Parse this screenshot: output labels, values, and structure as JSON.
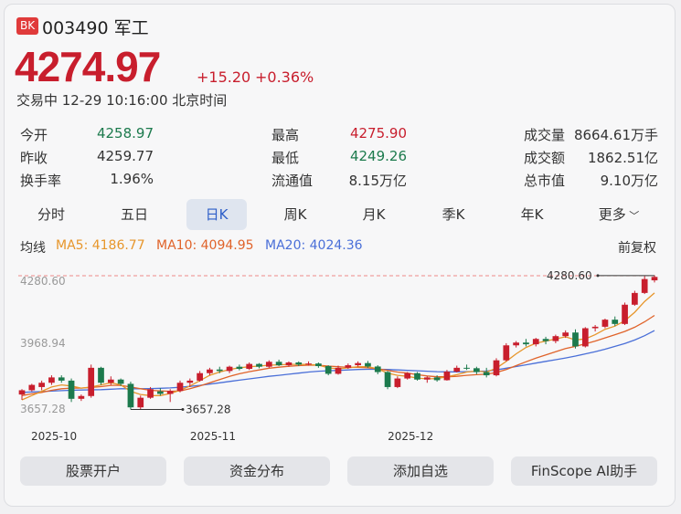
{
  "header": {
    "badge": "BK",
    "code_name": "003490 军工",
    "price": "4274.97",
    "change": "+15.20",
    "change_pct": "+0.36%",
    "status": "交易中 12-29 10:16:00 北京时间"
  },
  "stats": [
    {
      "label": "今开",
      "value": "4258.97",
      "color": "green"
    },
    {
      "label": "最高",
      "value": "4275.90",
      "color": "red"
    },
    {
      "label": "成交量",
      "value": "8664.61万手",
      "color": "dark"
    },
    {
      "label": "昨收",
      "value": "4259.77",
      "color": "dark"
    },
    {
      "label": "最低",
      "value": "4249.26",
      "color": "green"
    },
    {
      "label": "成交额",
      "value": "1862.51亿",
      "color": "dark"
    },
    {
      "label": "换手率",
      "value": "1.96%",
      "color": "dark"
    },
    {
      "label": "流通值",
      "value": "8.15万亿",
      "color": "dark"
    },
    {
      "label": "总市值",
      "value": "9.10万亿",
      "color": "dark"
    }
  ],
  "tabs": [
    "分时",
    "五日",
    "日K",
    "周K",
    "月K",
    "季K",
    "年K",
    "更多"
  ],
  "active_tab": "日K",
  "ma": {
    "label": "均线",
    "ma5": "MA5: 4186.77",
    "ma10": "MA10: 4094.95",
    "ma20": "MA20: 4024.36",
    "adjust": "前复权"
  },
  "colors": {
    "up": "#c81e2d",
    "down": "#1c7a4d",
    "ma5": "#e7962b",
    "ma10": "#e0632a",
    "ma20": "#4a6fd8",
    "active_tab": "#2d5ec8"
  },
  "chart_data": {
    "type": "candlestick",
    "y_ticks": [
      "4280.60",
      "3968.94",
      "3657.28"
    ],
    "ylim": [
      3657.28,
      4280.6
    ],
    "x_labels": [
      "2025-10",
      "2025-11",
      "2025-12"
    ],
    "x_label_index": [
      0,
      17,
      37
    ],
    "max_label": "4280.60",
    "min_label": "3657.28",
    "ohlc": [
      [
        3725,
        3750,
        3700,
        3745
      ],
      [
        3745,
        3775,
        3740,
        3770
      ],
      [
        3760,
        3790,
        3745,
        3780
      ],
      [
        3780,
        3815,
        3770,
        3805
      ],
      [
        3805,
        3815,
        3780,
        3790
      ],
      [
        3790,
        3800,
        3690,
        3705
      ],
      [
        3705,
        3725,
        3695,
        3718
      ],
      [
        3718,
        3865,
        3710,
        3850
      ],
      [
        3850,
        3855,
        3770,
        3780
      ],
      [
        3780,
        3810,
        3770,
        3795
      ],
      [
        3795,
        3800,
        3765,
        3775
      ],
      [
        3775,
        3785,
        3655,
        3665
      ],
      [
        3665,
        3720,
        3655,
        3710
      ],
      [
        3710,
        3760,
        3705,
        3750
      ],
      [
        3740,
        3755,
        3720,
        3728
      ],
      [
        3728,
        3750,
        3690,
        3742
      ],
      [
        3742,
        3790,
        3735,
        3780
      ],
      [
        3780,
        3800,
        3760,
        3790
      ],
      [
        3790,
        3835,
        3785,
        3825
      ],
      [
        3825,
        3850,
        3815,
        3842
      ],
      [
        3842,
        3855,
        3825,
        3835
      ],
      [
        3835,
        3860,
        3825,
        3855
      ],
      [
        3855,
        3865,
        3838,
        3845
      ],
      [
        3845,
        3875,
        3840,
        3868
      ],
      [
        3868,
        3872,
        3848,
        3855
      ],
      [
        3855,
        3885,
        3850,
        3878
      ],
      [
        3878,
        3888,
        3858,
        3862
      ],
      [
        3862,
        3880,
        3855,
        3875
      ],
      [
        3875,
        3880,
        3858,
        3865
      ],
      [
        3865,
        3880,
        3860,
        3870
      ],
      [
        3870,
        3875,
        3850,
        3858
      ],
      [
        3858,
        3862,
        3815,
        3822
      ],
      [
        3822,
        3860,
        3818,
        3850
      ],
      [
        3850,
        3870,
        3845,
        3862
      ],
      [
        3862,
        3880,
        3855,
        3872
      ],
      [
        3872,
        3882,
        3850,
        3856
      ],
      [
        3856,
        3862,
        3820,
        3830
      ],
      [
        3830,
        3835,
        3750,
        3760
      ],
      [
        3760,
        3810,
        3755,
        3800
      ],
      [
        3800,
        3830,
        3795,
        3825
      ],
      [
        3825,
        3830,
        3790,
        3795
      ],
      [
        3795,
        3810,
        3780,
        3805
      ],
      [
        3805,
        3815,
        3785,
        3792
      ],
      [
        3792,
        3840,
        3790,
        3832
      ],
      [
        3832,
        3860,
        3828,
        3850
      ],
      [
        3850,
        3865,
        3840,
        3848
      ],
      [
        3848,
        3855,
        3820,
        3830
      ],
      [
        3830,
        3850,
        3805,
        3815
      ],
      [
        3815,
        3895,
        3810,
        3885
      ],
      [
        3885,
        3965,
        3880,
        3955
      ],
      [
        3955,
        3975,
        3945,
        3968
      ],
      [
        3968,
        3985,
        3950,
        3960
      ],
      [
        3960,
        3990,
        3950,
        3985
      ],
      [
        3985,
        3995,
        3960,
        3975
      ],
      [
        3975,
        4005,
        3965,
        3998
      ],
      [
        3998,
        4025,
        3990,
        4015
      ],
      [
        4015,
        4030,
        3940,
        3950
      ],
      [
        3950,
        4040,
        3945,
        4035
      ],
      [
        4035,
        4050,
        4020,
        4042
      ],
      [
        4042,
        4080,
        4035,
        4075
      ],
      [
        4075,
        4090,
        4045,
        4055
      ],
      [
        4055,
        4155,
        4050,
        4145
      ],
      [
        4145,
        4210,
        4140,
        4200
      ],
      [
        4200,
        4280,
        4195,
        4265
      ],
      [
        4259,
        4281,
        4249,
        4275
      ]
    ],
    "ma5": [
      3700,
      3720,
      3740,
      3760,
      3770,
      3765,
      3755,
      3760,
      3770,
      3780,
      3770,
      3740,
      3725,
      3720,
      3720,
      3730,
      3745,
      3765,
      3790,
      3815,
      3830,
      3842,
      3850,
      3855,
      3858,
      3862,
      3864,
      3866,
      3866,
      3866,
      3862,
      3850,
      3845,
      3850,
      3855,
      3855,
      3845,
      3825,
      3815,
      3810,
      3802,
      3798,
      3800,
      3808,
      3818,
      3830,
      3835,
      3830,
      3848,
      3880,
      3915,
      3945,
      3965,
      3975,
      3985,
      3995,
      3980,
      3985,
      4005,
      4030,
      4045,
      4070,
      4110,
      4160,
      4200
    ],
    "ma10": [
      3720,
      3728,
      3735,
      3745,
      3752,
      3755,
      3755,
      3758,
      3762,
      3768,
      3768,
      3760,
      3752,
      3745,
      3742,
      3740,
      3742,
      3752,
      3765,
      3780,
      3795,
      3810,
      3822,
      3832,
      3840,
      3848,
      3853,
      3857,
      3860,
      3862,
      3862,
      3858,
      3855,
      3852,
      3852,
      3850,
      3845,
      3838,
      3830,
      3825,
      3818,
      3812,
      3808,
      3808,
      3810,
      3815,
      3818,
      3820,
      3828,
      3842,
      3860,
      3878,
      3895,
      3910,
      3925,
      3940,
      3950,
      3962,
      3975,
      3990,
      4005,
      4020,
      4040,
      4065,
      4095
    ],
    "ma20": [
      3735,
      3737,
      3739,
      3741,
      3743,
      3745,
      3746,
      3747,
      3748,
      3750,
      3752,
      3752,
      3752,
      3753,
      3754,
      3756,
      3759,
      3763,
      3768,
      3774,
      3780,
      3786,
      3792,
      3798,
      3804,
      3810,
      3815,
      3820,
      3825,
      3830,
      3834,
      3836,
      3838,
      3840,
      3842,
      3843,
      3843,
      3842,
      3840,
      3838,
      3836,
      3834,
      3832,
      3831,
      3831,
      3832,
      3833,
      3835,
      3840,
      3848,
      3856,
      3864,
      3872,
      3880,
      3888,
      3896,
      3905,
      3915,
      3925,
      3937,
      3950,
      3964,
      3980,
      4000,
      4024
    ]
  },
  "buttons": [
    "股票开户",
    "资金分布",
    "添加自选",
    "FinScope AI助手"
  ]
}
